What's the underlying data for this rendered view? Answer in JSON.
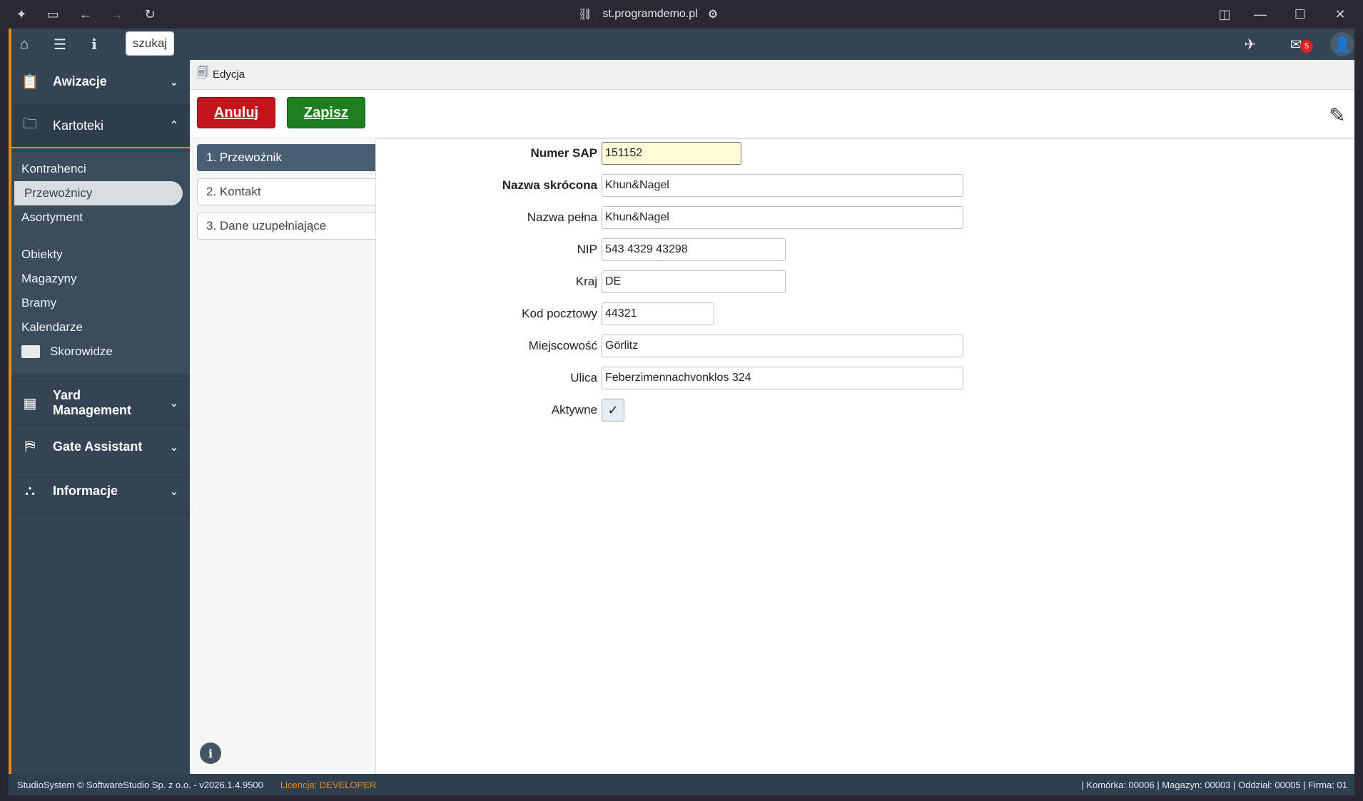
{
  "browser": {
    "url": "st.programdemo.pl"
  },
  "topbar": {
    "search_label": "szukaj",
    "mail_count": "5"
  },
  "sidebar": {
    "sections": [
      {
        "label": "Awizacje",
        "icon": "clipboard-icon"
      },
      {
        "label": "Kartoteki",
        "icon": "folder-icon"
      },
      {
        "label": "Yard Management",
        "icon": "grid-icon"
      },
      {
        "label": "Gate Assistant",
        "icon": "gate-icon"
      },
      {
        "label": "Informacje",
        "icon": "sitemap-icon"
      }
    ],
    "kartoteki_items": [
      "Kontrahenci",
      "Przewoźnicy",
      "Asortyment",
      "Obiekty",
      "Magazyny",
      "Bramy",
      "Kalendarze",
      "Skorowidze"
    ],
    "active_item": "Przewoźnicy"
  },
  "breadcrumb": {
    "label": "Edycja"
  },
  "toolbar": {
    "cancel_label": "Anuluj",
    "save_label": "Zapisz",
    "cancel_color": "#c4151c",
    "save_color": "#1e7f1e"
  },
  "tabs": [
    {
      "label": "1. Przewoźnik",
      "active": true
    },
    {
      "label": "2. Kontakt",
      "active": false
    },
    {
      "label": "3. Dane uzupełniające",
      "active": false
    }
  ],
  "form": {
    "numer_sap": {
      "label": "Numer SAP",
      "value": "151152"
    },
    "nazwa_skrocona": {
      "label": "Nazwa skrócona",
      "value": "Khun&Nagel"
    },
    "nazwa_pelna": {
      "label": "Nazwa pełna",
      "value": "Khun&Nagel"
    },
    "nip": {
      "label": "NIP",
      "value": "543 4329 43298"
    },
    "kraj": {
      "label": "Kraj",
      "value": "DE"
    },
    "kod_pocztowy": {
      "label": "Kod pocztowy",
      "value": "44321"
    },
    "miejscowosc": {
      "label": "Miejscowość",
      "value": "Görlitz"
    },
    "ulica": {
      "label": "Ulica",
      "value": "Feberzimennachvonklos 324"
    },
    "aktywne": {
      "label": "Aktywne",
      "value": "✓"
    }
  },
  "status": {
    "left": "StudioSystem © SoftwareStudio Sp. z o.o. - v2026.1.4.9500",
    "license_prefix": "Licencja: ",
    "license_value": "DEVELOPER",
    "right": "| Komórka: 00006 | Magazyn: 00003 | Oddział: 00005 | Firma: 01"
  }
}
